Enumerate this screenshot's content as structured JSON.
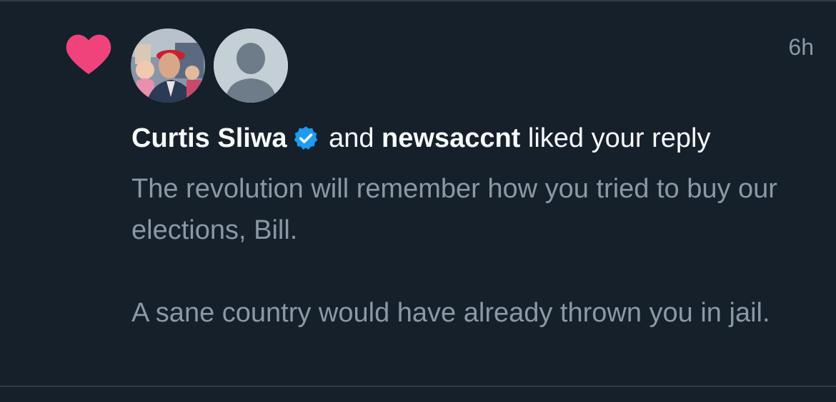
{
  "notification": {
    "type_icon": "heart-icon",
    "time": "6h",
    "avatars": [
      {
        "icon": "user-photo-avatar"
      },
      {
        "icon": "default-profile-avatar"
      }
    ],
    "user1_name": "Curtis Sliwa",
    "user1_verified_icon": "verified-badge-icon",
    "connector": "and",
    "user2_name": "newsaccnt",
    "action": "liked your reply",
    "reply_paragraph_1": "The revolution will remember how you tried to buy our elections, Bill.",
    "reply_paragraph_2": "A sane country would have already thrown you in jail."
  },
  "colors": {
    "background": "#15202b",
    "heart": "#f0437c",
    "primary_text": "#f7f9f9",
    "secondary_text": "#8b98a5",
    "verified": "#1d9bf0",
    "default_avatar_bg": "#c4cfd6"
  }
}
